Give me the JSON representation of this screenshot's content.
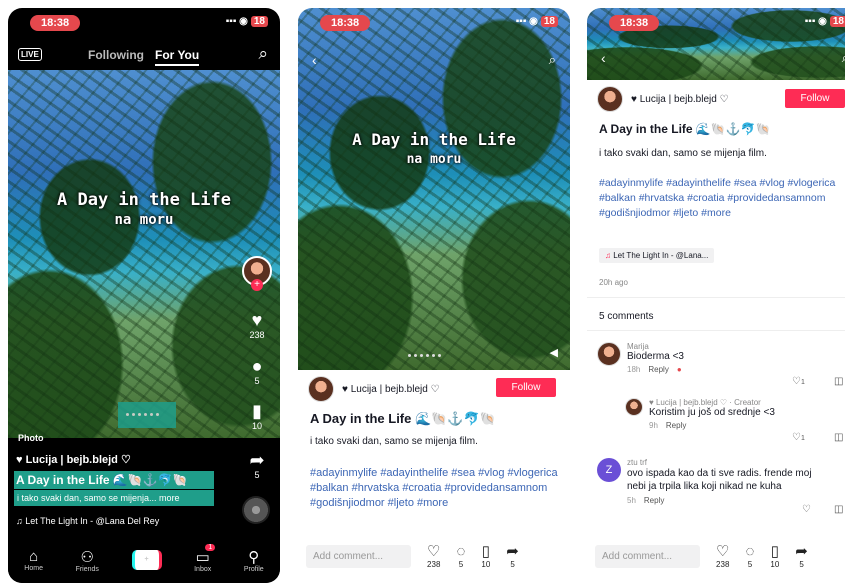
{
  "status": {
    "time": "18:38",
    "battery": "18"
  },
  "p1": {
    "live": "LIVE",
    "tabs": [
      "Following",
      "For You"
    ],
    "overlay": {
      "line1": "A Day in the Life",
      "line2": "na moru"
    },
    "likes": "238",
    "comments": "5",
    "saves": "10",
    "shares": "5",
    "badge": "Photo",
    "user": "♥ Lucija | bejb.blejd ♡",
    "caption_title": "A Day in the Life 🌊🐚⚓🐬🐚",
    "caption": "i tako svaki dan, samo se mijenja... more",
    "music": "♫ Let The Light In - @Lana Del Rey",
    "nav": [
      "Home",
      "Friends",
      "",
      "Inbox",
      "Profile"
    ],
    "inbox_badge": "1"
  },
  "post": {
    "user": "♥ Lucija | bejb.blejd ♡",
    "follow": "Follow",
    "title": "A Day in the Life 🌊🐚⚓🐬🐚",
    "desc": "i tako svaki dan, samo se mijenja film.",
    "tags": "#adayinmylife #adayinthelife #sea #vlog #vlogerica #balkan #hrvatska #croatia #providedansamnom #godišnjiodmor #ljeto #more",
    "music": "Let The Light In - @Lana...",
    "time": "20h ago",
    "comments_title": "5 comments",
    "add_comment": "Add comment...",
    "likes": "238",
    "comments": "5",
    "saves": "10",
    "shares": "5"
  },
  "comments": [
    {
      "name": "Marija",
      "text": "Bioderma <3",
      "time": "18h",
      "reply": "Reply",
      "likes": "1"
    },
    {
      "name": "♥ Lucija | bejb.blejd ♡ · Creator",
      "text": "Koristim ju još od srednje <3",
      "time": "9h",
      "reply": "Reply",
      "likes": "1"
    },
    {
      "name": "ztu trf",
      "text": "ovo ispada kao da ti sve radis. frende moj nebi ja trpila lika koji nikad ne kuha",
      "time": "5h",
      "reply": "Reply",
      "likes": ""
    }
  ]
}
